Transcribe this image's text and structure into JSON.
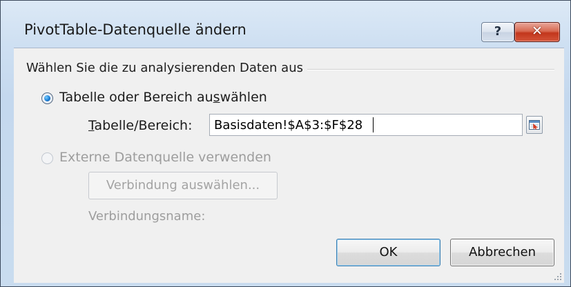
{
  "dialog": {
    "title": "PivotTable-Datenquelle ändern",
    "help_label": "?",
    "close_label": "✕"
  },
  "group": {
    "label": "Wählen Sie die zu analysierenden Daten aus"
  },
  "option_table": {
    "label_pre": "Tabelle oder Bereich au",
    "label_accel": "s",
    "label_post": "wählen",
    "selected": true
  },
  "range": {
    "label_accel": "T",
    "label_rest": "abelle/Bereich:",
    "value": "Basisdaten!$A$3:$F$28"
  },
  "option_external": {
    "label": "Externe Datenquelle verwenden",
    "selected": false,
    "enabled": false
  },
  "connection": {
    "button_label": "Verbindung auswählen...",
    "name_label": "Verbindungsname:"
  },
  "buttons": {
    "ok": "OK",
    "cancel": "Abbrechen"
  },
  "icons": {
    "help": "help-icon",
    "close": "close-icon",
    "collapse": "collapse-dialog-icon"
  },
  "colors": {
    "title_gradient_top": "#dce9f6",
    "close_red": "#c2361c",
    "radio_dot": "#1c7ed6",
    "default_button_border": "#3c7fb1"
  }
}
